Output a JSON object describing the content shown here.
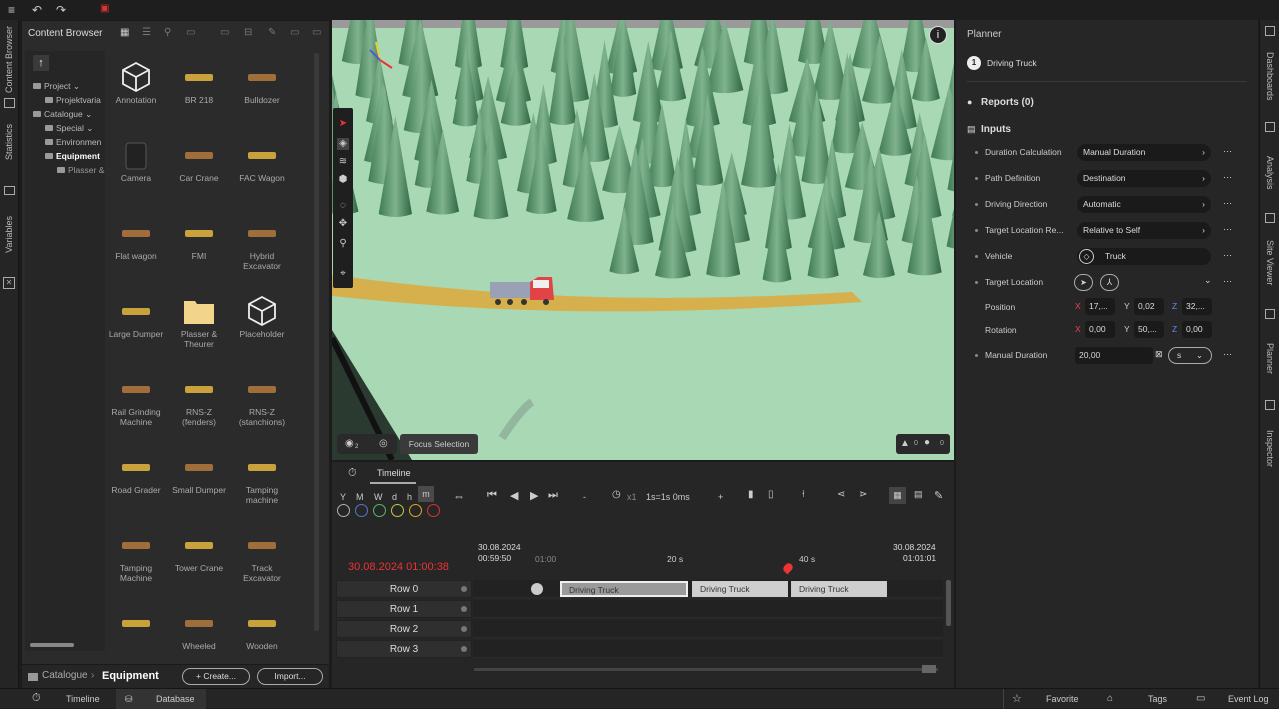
{
  "left_rail": {
    "tab_content_browser": "Content Browser",
    "tab_statistics": "Statistics",
    "tab_variables": "Variables"
  },
  "right_rail": {
    "tab_dashboards": "Dashboards",
    "tab_analysis": "Analysis",
    "tab_site_viewer": "Site Viewer",
    "tab_planner": "Planner",
    "tab_inspector": "Inspector"
  },
  "content_browser": {
    "title": "Content Browser",
    "tree": [
      "Project",
      "Projektvaria",
      "Catalogue",
      "Special",
      "Environmen",
      "Equipment",
      "Plasser &"
    ],
    "items": [
      {
        "label": "Annotation",
        "icon": "cube-outline-icon"
      },
      {
        "label": "BR 218",
        "icon": "locomotive-icon"
      },
      {
        "label": "Bulldozer",
        "icon": "bulldozer-icon"
      },
      {
        "label": "Camera",
        "icon": "camera-icon"
      },
      {
        "label": "Car Crane",
        "icon": "car-crane-icon"
      },
      {
        "label": "FAC Wagon",
        "icon": "wagon-icon"
      },
      {
        "label": "Flat wagon",
        "icon": "flat-wagon-icon"
      },
      {
        "label": "FMI",
        "icon": "fmi-icon"
      },
      {
        "label": "Hybrid Excavator",
        "icon": "excavator-icon"
      },
      {
        "label": "Large Dumper",
        "icon": "dumper-icon"
      },
      {
        "label": "Plasser & Theurer",
        "icon": "folder-icon"
      },
      {
        "label": "Placeholder",
        "icon": "cube-outline-icon"
      },
      {
        "label": "Rail Grinding Machine",
        "icon": "rail-machine-icon"
      },
      {
        "label": "RNS-Z (fenders)",
        "icon": "rail-icon"
      },
      {
        "label": "RNS-Z (stanchions)",
        "icon": "rail-icon"
      },
      {
        "label": "Road Grader",
        "icon": "grader-icon"
      },
      {
        "label": "Small Dumper",
        "icon": "dumper-icon"
      },
      {
        "label": "Tamping machine",
        "icon": "tamping-icon"
      },
      {
        "label": "Tamping Machine",
        "icon": "tamping-icon"
      },
      {
        "label": "Tower Crane",
        "icon": "tower-crane-icon"
      },
      {
        "label": "Track Excavator",
        "icon": "excavator-icon"
      },
      {
        "label": "",
        "icon": "truck-icon"
      },
      {
        "label": "Wheeled",
        "icon": "loader-icon"
      },
      {
        "label": "Wooden",
        "icon": "wooden-icon"
      }
    ],
    "breadcrumb_root": "Catalogue",
    "breadcrumb_current": "Equipment",
    "create_label": "+ Create...",
    "import_label": "Import..."
  },
  "viewport": {
    "focus_selection": "Focus Selection",
    "warnings": "0",
    "infos": "0",
    "layer_badge": "2"
  },
  "timeline": {
    "title": "Timeline",
    "zoom_units": [
      "Y",
      "M",
      "W",
      "d",
      "h",
      "m"
    ],
    "speed_minus": "-",
    "speed_multiplier": "x1",
    "speed": "1s=1s 0ms",
    "speed_plus": "+",
    "current_time": "30.08.2024 01:00:38",
    "start_date": "30.08.2024",
    "start_time": "00:59:50",
    "tick_1": "01:00",
    "tick_2": "20 s",
    "tick_3": "40 s",
    "end_date": "30.08.2024",
    "end_time": "01:01:01",
    "rows": [
      "Row 0",
      "Row 1",
      "Row 2",
      "Row 3"
    ],
    "clips": [
      "Driving Truck",
      "Driving Truck",
      "Driving Truck"
    ],
    "colors": [
      "#b0b0b0",
      "#5577cc",
      "#55bb66",
      "#bbcc44",
      "#ddaa22",
      "#dd3333"
    ]
  },
  "planner": {
    "title": "Planner",
    "step_number": "1",
    "step_label": "Driving Truck",
    "reports": "Reports (0)",
    "inputs": "Inputs",
    "rows": [
      {
        "key": "Duration Calculation",
        "value": "Manual Duration"
      },
      {
        "key": "Path Definition",
        "value": "Destination"
      },
      {
        "key": "Driving Direction",
        "value": "Automatic"
      },
      {
        "key": "Target Location Re...",
        "value": "Relative to Self"
      },
      {
        "key": "Vehicle",
        "value": "Truck"
      },
      {
        "key": "Target Location",
        "value": ""
      }
    ],
    "position_label": "Position",
    "position": {
      "x": "17,...",
      "y": "0,02",
      "z": "32,..."
    },
    "rotation_label": "Rotation",
    "rotation": {
      "x": "0,00",
      "y": "50,...",
      "z": "0,00"
    },
    "manual_duration_label": "Manual Duration",
    "manual_duration_value": "20,00",
    "manual_duration_unit": "s",
    "axis_x": "X",
    "axis_y": "Y",
    "axis_z": "Z"
  },
  "status_bar": {
    "timeline": "Timeline",
    "database": "Database",
    "favorite": "Favorite",
    "tags": "Tags",
    "event_log": "Event Log"
  }
}
